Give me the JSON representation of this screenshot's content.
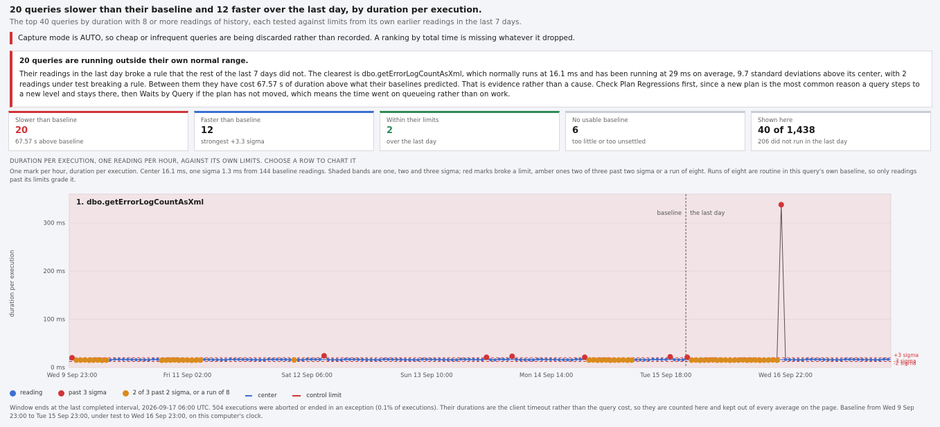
{
  "header": {
    "title": "20 queries slower than their baseline and 12 faster over the last day, by duration per execution.",
    "subtitle": "The top 40 queries by duration with 8 or more readings of history, each tested against limits from its own earlier readings in the last 7 days."
  },
  "notice": "Capture mode is AUTO, so cheap or infrequent queries are being discarded rather than recorded. A ranking by total time is missing whatever it dropped.",
  "alert": {
    "heading": "20 queries are running outside their own normal range.",
    "body": "Their readings in the last day broke a rule that the rest of the last 7 days did not. The clearest is dbo.getErrorLogCountAsXml, which normally runs at 16.1 ms and has been running at 29 ms on average, 9.7 standard deviations above its center, with 2 readings under test breaking a rule. Between them they have cost 67.57 s of duration above what their baselines predicted. That is evidence rather than a cause. Check Plan Regressions first, since a new plan is the most common reason a query steps to a new level and stays there, then Waits by Query if the plan has not moved, which means the time went on queueing rather than on work."
  },
  "cards": [
    {
      "label": "Slower than baseline",
      "value": "20",
      "sub": "67.57 s above baseline",
      "accent": "#d13438",
      "value_color": "#d13438"
    },
    {
      "label": "Faster than baseline",
      "value": "12",
      "sub": "strongest +3.3 sigma",
      "accent": "#3b6fd3",
      "value_color": "#1b1b1b"
    },
    {
      "label": "Within their limits",
      "value": "2",
      "sub": "over the last day",
      "accent": "#2e8b57",
      "value_color": "#2e8b57"
    },
    {
      "label": "No usable baseline",
      "value": "6",
      "sub": "too little or too unsettled",
      "accent": "#c8cdd8",
      "value_color": "#1b1b1b"
    },
    {
      "label": "Shown here",
      "value": "40 of 1,438",
      "sub": "206 did not run in the last day",
      "accent": "#c8cdd8",
      "value_color": "#1b1b1b"
    }
  ],
  "section": {
    "caption": "DURATION PER EXECUTION, ONE READING PER HOUR, AGAINST ITS OWN LIMITS. CHOOSE A ROW TO CHART IT",
    "explain": "One mark per hour, duration per execution. Center 16.1 ms, one sigma 1.3 ms from 144 baseline readings. Shaded bands are one, two and three sigma; red marks broke a limit, amber ones two of three past two sigma or a run of eight. Runs of eight are routine in this query's own baseline, so only readings past its limits grade it."
  },
  "chart_data": {
    "type": "line",
    "title": "1. dbo.getErrorLogCountAsXml",
    "ylabel": "duration per execution",
    "ylim": [
      0,
      360
    ],
    "yticks": [
      "0 ms",
      "100 ms",
      "200 ms",
      "300 ms"
    ],
    "ytick_values": [
      0,
      100,
      200,
      300
    ],
    "xlim": [
      0,
      191
    ],
    "xticks": [
      "Wed 9 Sep 23:00",
      "Fri 11 Sep 02:00",
      "Sat 12 Sep 06:00",
      "Sun 13 Sep 10:00",
      "Mon 14 Sep 14:00",
      "Tue 15 Sep 18:00",
      "Wed 16 Sep 22:00"
    ],
    "xtick_hours": [
      0,
      27,
      55,
      83,
      111,
      139,
      167
    ],
    "test_start_hour": 144,
    "center": 16.1,
    "sigma": 1.3,
    "baseline_label": "baseline",
    "test_label": "the last day",
    "band_labels": [
      "+3 sigma",
      "-3 sigma",
      "-2 sigma"
    ],
    "series_legend": [
      "reading",
      "past 3 sigma",
      "2 of 3 past 2 sigma, or a run of 8",
      "center",
      "control limit"
    ],
    "colors": {
      "reading": "#3b6fd3",
      "past3": "#d13438",
      "run": "#d98b1c",
      "band": "#f2e4e6"
    },
    "runs": [
      [
        1,
        8
      ],
      [
        21,
        30
      ],
      [
        52,
        52
      ],
      [
        120,
        131
      ],
      [
        145,
        166
      ]
    ],
    "past3_points": [
      [
        0,
        20
      ],
      [
        59,
        24
      ],
      [
        97,
        21
      ],
      [
        103,
        23
      ],
      [
        120,
        21
      ],
      [
        140,
        22
      ],
      [
        144,
        21
      ],
      [
        166,
        338
      ]
    ]
  },
  "legend": [
    "reading",
    "past 3 sigma",
    "2 of 3 past 2 sigma, or a run of 8",
    "center",
    "control limit"
  ],
  "footer": "Window ends at the last completed interval, 2026-09-17 06:00 UTC.    504 executions were aborted or ended in an exception (0.1% of executions). Their durations are the client timeout rather than the query cost, so they are counted here and kept out of every average on the page.    Baseline from Wed 9 Sep 23:00 to Tue 15 Sep 23:00, under test to Wed 16 Sep 23:00, on this computer's clock."
}
